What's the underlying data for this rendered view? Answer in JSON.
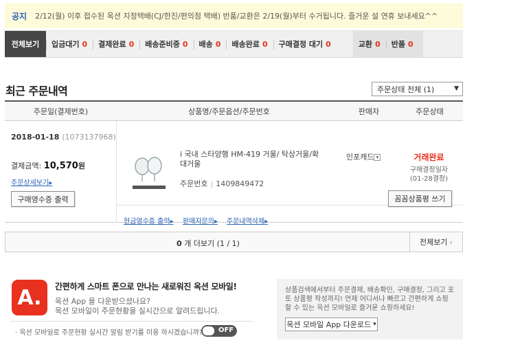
{
  "notice": {
    "label": "공지",
    "message": "2/12(월) 이후 접수된 옥션 지정택배(CJ/한진/편의점 택배) 반품/교환은 2/19(월)부터 수거됩니다. 즐거운 설 연휴 보내세요^^"
  },
  "tabs": [
    {
      "label": "전체보기",
      "count": ""
    },
    {
      "label": "입금대기",
      "count": "0"
    },
    {
      "label": "결제완료",
      "count": "0"
    },
    {
      "label": "배송준비중",
      "count": "0"
    },
    {
      "label": "배송",
      "count": "0"
    },
    {
      "label": "배송완료",
      "count": "0"
    },
    {
      "label": "구매결정 대기",
      "count": "0"
    },
    {
      "label": "교환",
      "count": "0"
    },
    {
      "label": "반품",
      "count": "0"
    }
  ],
  "section": {
    "title": "최근 주문내역",
    "status_filter": "주문상태 전체 (1)"
  },
  "table": {
    "headers": [
      "주문일(결제번호)",
      "상품명/주문옵션/주문번호",
      "판매자",
      "주문상태"
    ]
  },
  "order": {
    "date": "2018-01-18",
    "payment_no": "(1073137968)",
    "pay_label": "결제금액:",
    "amount": "10,570",
    "amount_unit": "원",
    "detail_link": "주문상세보기",
    "receipt_button": "구매영수증 출력",
    "product_name": "i 국내 스타양행 HM-419 거울/ 탁상거울/확대거울",
    "order_no_label": "주문번호",
    "order_no": "1409849472",
    "seller": "인포캐드",
    "status": "거래완료",
    "status_sub": "구매결정일자",
    "status_date": "(01-28결정)",
    "actions": [
      "현금영수증 출력",
      "판매자문의",
      "주문내역삭제"
    ],
    "review_button": "꼼꼼상품평 쓰기"
  },
  "pager": {
    "count": "0",
    "text": "개 더보기 (1 / 1)",
    "view_all": "전체보기"
  },
  "app_promo": {
    "logo": "A.",
    "headline": "간편하게 스마트 폰으로 만나는 새로워진 옥션 모바일!",
    "line1": "옥션 App 을 다운받으셨나요?",
    "line2": "옥션 모바일이 주문현황을 실시간으로 알려드립니다.",
    "alarm_text": "옥션 모바일로 주문현황 실시간 알림 받기를 이용 하시겠습니까?",
    "toggle_label": "OFF"
  },
  "side_promo": {
    "text": "상품검색에서부터 주문결제, 배송확인, 구매결정, 그리고 포토 상품평 작성까지! 언제 어디서나 빠르고 간편하게 쇼핑할 수 있는 옥션 모바일로 즐거운 쇼핑하세요!",
    "download_button": "옥션 모바일 App 다운로드"
  },
  "colors": {
    "accent_red": "#e8311f",
    "link_blue": "#2d64b8",
    "tab_active": "#464646"
  }
}
